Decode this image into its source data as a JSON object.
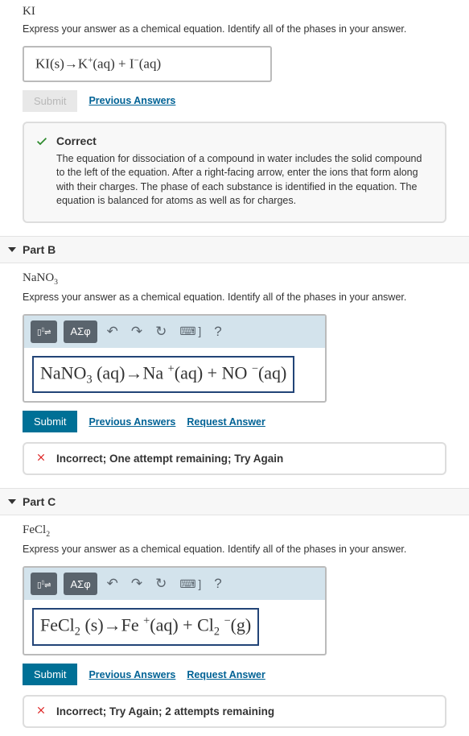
{
  "partA": {
    "compound": "KI",
    "instruction": "Express your answer as a chemical equation. Identify all of the phases in your answer.",
    "equationHtml": "KI(s)→K<sup>+</sup>(aq) + I<sup>−</sup>(aq)",
    "submit": "Submit",
    "previous": "Previous Answers",
    "feedback": {
      "title": "Correct",
      "text": "The equation for dissociation of a compound in water includes the solid compound to the left of the equation. After a right-facing arrow, enter the ions that form along with their charges. The phase of each substance is identified in the equation. The equation is balanced for atoms as well as for charges."
    }
  },
  "partB": {
    "label": "Part B",
    "compoundHtml": "NaNO<sub>3</sub>",
    "instruction": "Express your answer as a chemical equation. Identify all of the phases in your answer.",
    "toolbar": {
      "greek": "ΑΣφ",
      "help": "?"
    },
    "equationHtml": "NaNO<sub>3</sub> (aq)→Na <sup>+</sup>(aq) + NO <sup>−</sup>(aq)",
    "submit": "Submit",
    "previous": "Previous Answers",
    "request": "Request Answer",
    "feedback": "Incorrect; One attempt remaining; Try Again"
  },
  "partC": {
    "label": "Part C",
    "compoundHtml": "FeCl<sub>2</sub>",
    "instruction": "Express your answer as a chemical equation. Identify all of the phases in your answer.",
    "toolbar": {
      "greek": "ΑΣφ",
      "help": "?"
    },
    "equationHtml": "FeCl<sub>2</sub> (s)→Fe <sup>+</sup>(aq) + Cl<sub>2</sub> <sup>−</sup>(g)",
    "submit": "Submit",
    "previous": "Previous Answers",
    "request": "Request Answer",
    "feedback": "Incorrect; Try Again; 2 attempts remaining"
  }
}
